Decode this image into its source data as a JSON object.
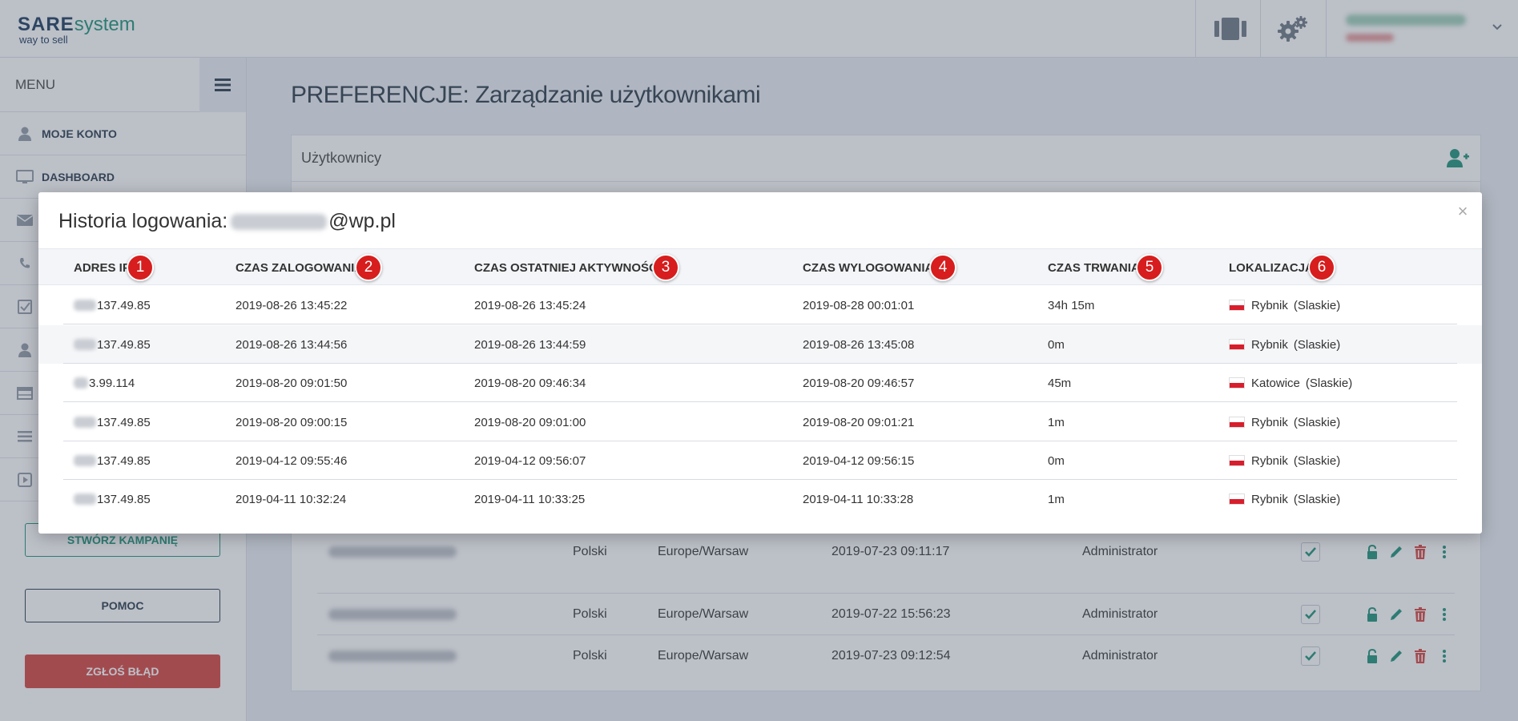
{
  "app": {
    "logo_brand": "SARE",
    "logo_product": "system",
    "logo_tagline": "way to sell"
  },
  "topbar": {
    "icons": [
      "layout-icon",
      "gears-icon",
      "chevron-down-icon"
    ]
  },
  "sidebar": {
    "menu_label": "MENU",
    "items": [
      {
        "label": "MOJE KONTO",
        "icon": "user-icon"
      },
      {
        "label": "DASHBOARD",
        "icon": "monitor-icon"
      },
      {
        "label": "",
        "icon": "envelope-icon"
      },
      {
        "label": "",
        "icon": "phone-icon"
      },
      {
        "label": "",
        "icon": "checkbox-icon"
      },
      {
        "label": "",
        "icon": "user-icon"
      },
      {
        "label": "",
        "icon": "table-icon"
      },
      {
        "label": "",
        "icon": "list-icon"
      },
      {
        "label": "",
        "icon": "play-icon"
      }
    ],
    "create_campaign_label": "STWÓRZ KAMPANIĘ",
    "help_label": "POMOC",
    "report_bug_label": "ZGŁOŚ BŁĄD"
  },
  "main": {
    "page_title": "PREFERENCJE: Zarządzanie użytkownikami",
    "panel_title": "Użytkownicy",
    "users": [
      {
        "language": "Polski",
        "timezone": "Europe/Warsaw",
        "date": "2019-07-23 09:11:17",
        "role": "Administrator"
      },
      {
        "language": "Polski",
        "timezone": "Europe/Warsaw",
        "date": "2019-07-22 15:56:23",
        "role": "Administrator"
      },
      {
        "language": "Polski",
        "timezone": "Europe/Warsaw",
        "date": "2019-07-23 09:12:54",
        "role": "Administrator"
      }
    ]
  },
  "modal": {
    "title_prefix": "Historia logowania:",
    "title_domain": "@wp.pl",
    "close_label": "×",
    "columns": [
      {
        "label": "ADRES IP",
        "badge": "1"
      },
      {
        "label": "CZAS ZALOGOWANIA",
        "badge": "2"
      },
      {
        "label": "CZAS OSTATNIEJ AKTYWNOŚCI",
        "badge": "3"
      },
      {
        "label": "CZAS WYLOGOWANIA",
        "badge": "4"
      },
      {
        "label": "CZAS TRWANIA",
        "badge": "5"
      },
      {
        "label": "LOKALIZACJA",
        "badge": "6"
      }
    ],
    "rows": [
      {
        "ip": "137.49.85",
        "login": "2019-08-26 13:45:22",
        "last_activity": "2019-08-26 13:45:24",
        "logout": "2019-08-28 00:01:01",
        "duration": "34h 15m",
        "city": "Rybnik",
        "region": "(Slaskie)"
      },
      {
        "ip": "137.49.85",
        "login": "2019-08-26 13:44:56",
        "last_activity": "2019-08-26 13:44:59",
        "logout": "2019-08-26 13:45:08",
        "duration": "0m",
        "city": "Rybnik",
        "region": "(Slaskie)"
      },
      {
        "ip": "3.99.114",
        "login": "2019-08-20 09:01:50",
        "last_activity": "2019-08-20 09:46:34",
        "logout": "2019-08-20 09:46:57",
        "duration": "45m",
        "city": "Katowice",
        "region": "(Slaskie)"
      },
      {
        "ip": "137.49.85",
        "login": "2019-08-20 09:00:15",
        "last_activity": "2019-08-20 09:01:00",
        "logout": "2019-08-20 09:01:21",
        "duration": "1m",
        "city": "Rybnik",
        "region": "(Slaskie)"
      },
      {
        "ip": "137.49.85",
        "login": "2019-04-12 09:55:46",
        "last_activity": "2019-04-12 09:56:07",
        "logout": "2019-04-12 09:56:15",
        "duration": "0m",
        "city": "Rybnik",
        "region": "(Slaskie)"
      },
      {
        "ip": "137.49.85",
        "login": "2019-04-11 10:32:24",
        "last_activity": "2019-04-11 10:33:25",
        "logout": "2019-04-11 10:33:28",
        "duration": "1m",
        "city": "Rybnik",
        "region": "(Slaskie)"
      }
    ]
  },
  "colors": {
    "accent_green": "#2e9b84",
    "danger_red": "#d9534f",
    "badge_red": "#d71d1d",
    "brand_navy": "#2d4b6b",
    "flag_poland_red": "#d81e2c"
  }
}
